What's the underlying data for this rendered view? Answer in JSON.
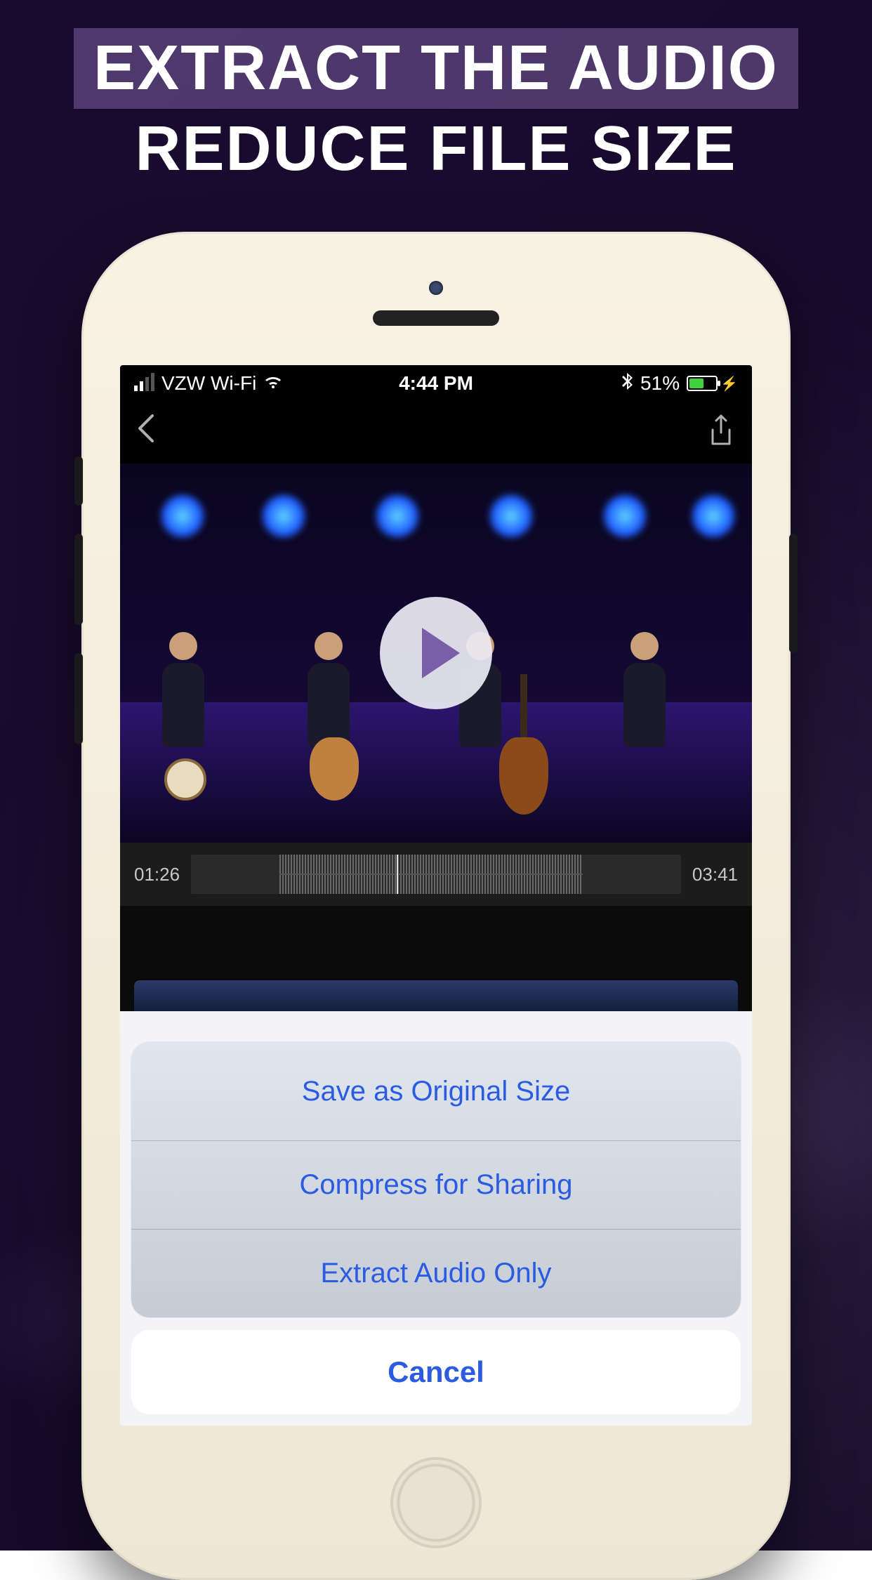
{
  "promo": {
    "line1": "EXTRACT THE AUDIO",
    "line2": "REDUCE FILE SIZE"
  },
  "statusbar": {
    "carrier": "VZW Wi-Fi",
    "time": "4:44 PM",
    "battery_pct": "51%"
  },
  "timeline": {
    "current": "01:26",
    "total": "03:41"
  },
  "actionsheet": {
    "options": [
      "Save as Original Size",
      "Compress for Sharing",
      "Extract Audio Only"
    ],
    "cancel": "Cancel"
  }
}
